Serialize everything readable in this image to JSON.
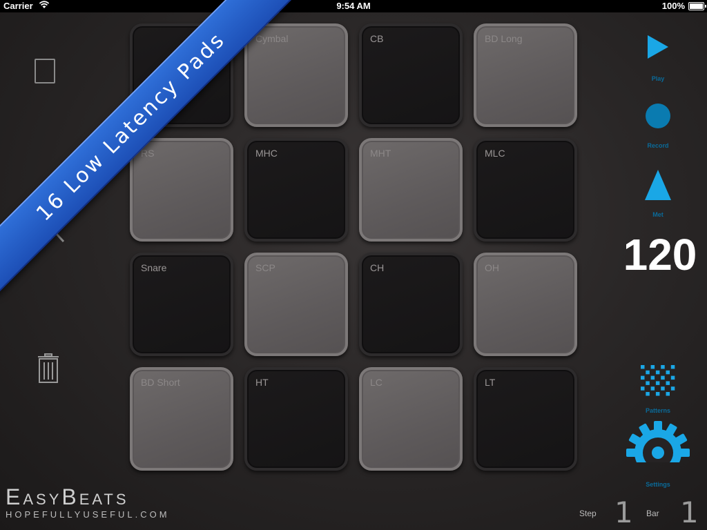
{
  "status_bar": {
    "carrier": "Carrier",
    "time": "9:54 AM",
    "battery": "100%"
  },
  "banner": {
    "text": "16 Low Latency Pads"
  },
  "pads": [
    {
      "label": "",
      "style": "dark"
    },
    {
      "label": "Cymbal",
      "style": "light"
    },
    {
      "label": "CB",
      "style": "dark"
    },
    {
      "label": "BD Long",
      "style": "light"
    },
    {
      "label": "RS",
      "style": "light"
    },
    {
      "label": "MHC",
      "style": "dark"
    },
    {
      "label": "MHT",
      "style": "light"
    },
    {
      "label": "MLC",
      "style": "dark"
    },
    {
      "label": "Snare",
      "style": "dark"
    },
    {
      "label": "SCP",
      "style": "light"
    },
    {
      "label": "CH",
      "style": "dark"
    },
    {
      "label": "OH",
      "style": "light"
    },
    {
      "label": "BD Short",
      "style": "light"
    },
    {
      "label": "HT",
      "style": "dark"
    },
    {
      "label": "LC",
      "style": "light"
    },
    {
      "label": "LT",
      "style": "dark"
    }
  ],
  "controls": {
    "play": "Play",
    "record": "Record",
    "met": "Met",
    "tempo": "120",
    "patterns": "Patterns",
    "settings": "Settings"
  },
  "counters": {
    "step_label": "Step",
    "step_value": "1",
    "bar_label": "Bar",
    "bar_value": "1"
  },
  "logo": {
    "brand": "EasyBeats",
    "url": "hopefullyuseful.com"
  },
  "colors": {
    "accent": "#1aa7e6",
    "record": "#0a7bb0",
    "caption": "#0a6b9a"
  }
}
